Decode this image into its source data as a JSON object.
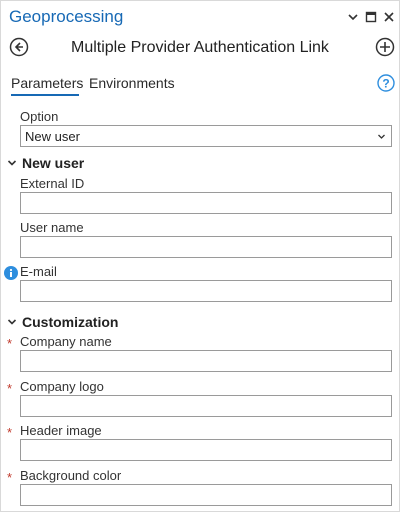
{
  "window": {
    "title": "Geoprocessing"
  },
  "tool": {
    "title": "Multiple Provider Authentication Link"
  },
  "tabs": [
    {
      "label": "Parameters"
    },
    {
      "label": "Environments"
    }
  ],
  "option": {
    "label": "Option",
    "value": "New user"
  },
  "sections": {
    "new_user": {
      "title": "New user",
      "fields": [
        {
          "label": "External ID",
          "value": ""
        },
        {
          "label": "User name",
          "value": ""
        },
        {
          "label": "E-mail",
          "value": ""
        }
      ]
    },
    "customization": {
      "title": "Customization",
      "required_marker": "*",
      "fields": [
        {
          "label": "Company name",
          "value": ""
        },
        {
          "label": "Company logo",
          "value": ""
        },
        {
          "label": "Header image",
          "value": ""
        },
        {
          "label": "Background color",
          "value": ""
        }
      ]
    }
  },
  "colors": {
    "accent": "#1769b5",
    "required": "#c0392b",
    "info": "#2e8ede"
  },
  "icons": [
    "chevron-down-icon",
    "maximize-icon",
    "close-icon",
    "back-icon",
    "add-icon",
    "help-icon",
    "expand-chevron-icon",
    "info-icon"
  ]
}
